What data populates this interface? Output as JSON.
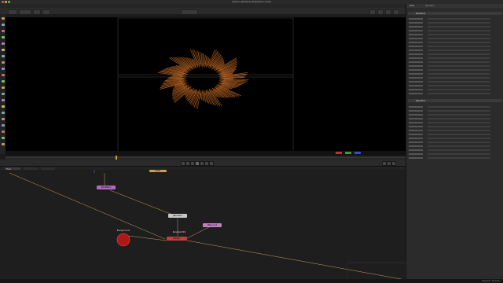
{
  "window": {
    "title": "Lesson_Particles_Explosion.comp"
  },
  "viewer": {
    "name": "Viewer1",
    "zoom": "100%",
    "fit_label": "Fit"
  },
  "timeline": {
    "start": "0",
    "end": "400",
    "marker": "12"
  },
  "flow": {
    "tab_label": "Flow"
  },
  "inspector": {
    "tabs": [
      "Tools",
      "Modifiers"
    ],
    "section_title": "pEmitter1",
    "subsection_title": "pRender1"
  },
  "nodes": [
    {
      "id": "n1",
      "label": "pEmitter1",
      "color": "#b06abf"
    },
    {
      "id": "n2",
      "label": "pRender1",
      "color": "#c7c7c7"
    },
    {
      "id": "n3",
      "label": "Merge1",
      "color": "#c04040"
    },
    {
      "id": "n4",
      "label": "pBounce1",
      "color": "#c080c0"
    },
    {
      "id": "n5",
      "label": "pKill1",
      "color": "#c8a050"
    },
    {
      "id": "n6",
      "label": "Background1",
      "color": "#e14b3c"
    },
    {
      "id": "n7",
      "label": "Renderer3D1",
      "color": "#d06050"
    }
  ],
  "status": {
    "text": "Playback: 24.0 fps"
  }
}
